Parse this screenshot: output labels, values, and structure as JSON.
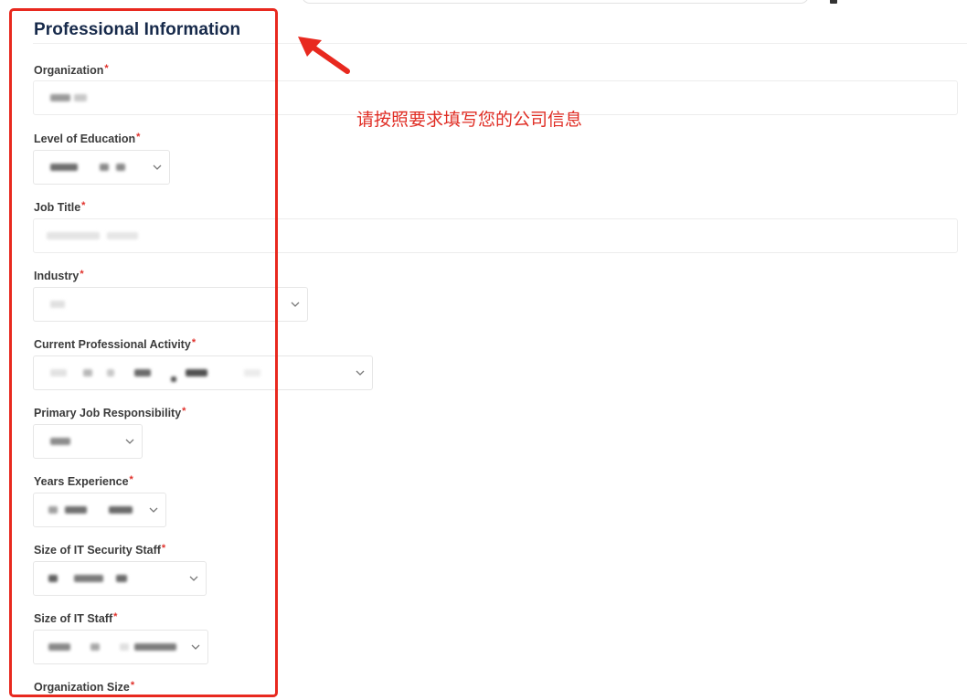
{
  "section": {
    "title": "Professional Information"
  },
  "required_marker": "*",
  "fields": {
    "organization": {
      "label": "Organization"
    },
    "education": {
      "label": "Level of Education"
    },
    "job_title": {
      "label": "Job Title"
    },
    "industry": {
      "label": "Industry"
    },
    "activity": {
      "label": "Current Professional Activity"
    },
    "responsibility": {
      "label": "Primary Job Responsibility"
    },
    "experience": {
      "label": "Years Experience"
    },
    "security_staff": {
      "label": "Size of IT Security Staff"
    },
    "it_staff": {
      "label": "Size of IT Staff"
    },
    "org_size": {
      "label": "Organization Size"
    }
  },
  "annotation": {
    "text": "请按照要求填写您的公司信息",
    "color": "#e02d24"
  },
  "icons": {
    "dropdown": "chevron-down-icon",
    "pointer": "red-arrow-icon"
  },
  "colors": {
    "title": "#16294a",
    "required": "#e0312b",
    "highlight": "#e8291f"
  }
}
